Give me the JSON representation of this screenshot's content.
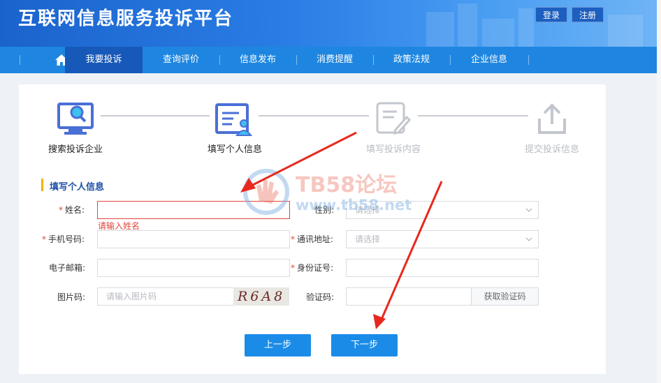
{
  "header": {
    "site_title": "互联网信息服务投诉平台",
    "login_label": "登录",
    "register_label": "注册"
  },
  "nav": {
    "home_icon": "home-icon",
    "items": [
      "我要投诉",
      "查询评价",
      "信息发布",
      "消费提醒",
      "政策法规",
      "企业信息"
    ],
    "active_index": 0
  },
  "steps": [
    {
      "label": "搜索投诉企业",
      "icon": "monitor-search-icon",
      "state": "done"
    },
    {
      "label": "填写个人信息",
      "icon": "user-form-icon",
      "state": "current"
    },
    {
      "label": "填写投诉内容",
      "icon": "edit-document-icon",
      "state": "todo"
    },
    {
      "label": "提交投诉信息",
      "icon": "upload-icon",
      "state": "todo"
    }
  ],
  "form": {
    "section_title": "填写个人信息",
    "name_label": "姓名:",
    "name_error": "请输入姓名",
    "gender_label": "性别:",
    "gender_placeholder": "请选择",
    "phone_label": "手机号码:",
    "address_label": "通讯地址:",
    "address_placeholder": "请选择",
    "email_label": "电子邮箱:",
    "id_label": "身份证号:",
    "captcha_label": "图片码:",
    "captcha_placeholder": "请输入图片码",
    "captcha_text": "R6A8",
    "sms_label": "验证码:",
    "sms_button": "获取验证码",
    "required_mark": "*"
  },
  "buttons": {
    "prev": "上一步",
    "next": "下一步"
  },
  "watermark": {
    "brand": "TB58论坛",
    "url": "www.tb58.net"
  },
  "colors": {
    "primary": "#1a8ce8",
    "nav": "#1e86e0",
    "nav_active": "#1659b8",
    "error": "#e0463a",
    "section_bar": "#f0b400",
    "annotation_arrow": "#e8281e"
  }
}
